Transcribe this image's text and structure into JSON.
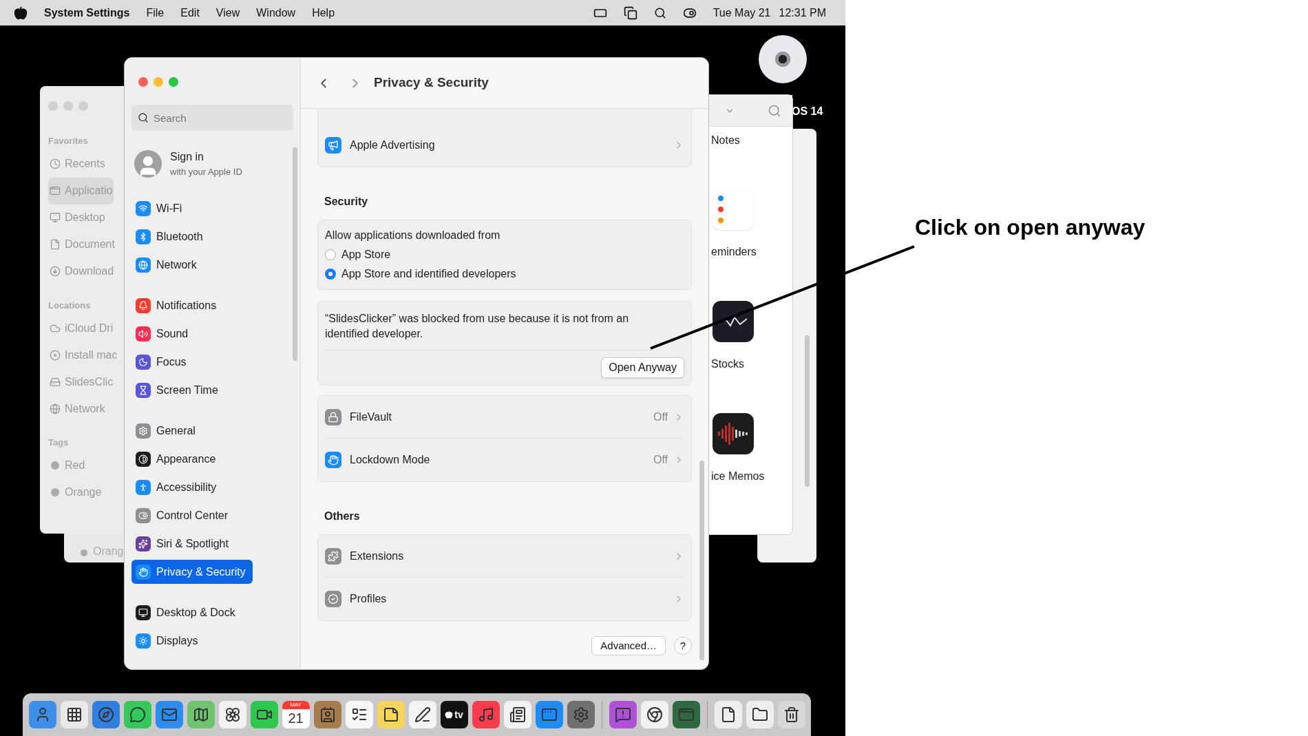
{
  "menu_bar": {
    "app": "System Settings",
    "menus": [
      "File",
      "Edit",
      "View",
      "Window",
      "Help"
    ],
    "date": "Tue May 21",
    "time": "12:31 PM"
  },
  "desktop": {
    "disc_label": "OS 14"
  },
  "finder": {
    "sections": [
      {
        "title": "Favorites",
        "items": [
          {
            "label": "Recents",
            "kind": "clock",
            "selected": false
          },
          {
            "label": "Applicatio",
            "kind": "apps",
            "selected": true
          },
          {
            "label": "Desktop",
            "kind": "desktop",
            "selected": false
          },
          {
            "label": "Document",
            "kind": "doc",
            "selected": false
          },
          {
            "label": "Download",
            "kind": "download",
            "selected": false
          }
        ]
      },
      {
        "title": "Locations",
        "items": [
          {
            "label": "iCloud Dri",
            "kind": "cloud",
            "selected": false
          },
          {
            "label": "Install mac",
            "kind": "disc",
            "selected": false
          },
          {
            "label": "SlidesClic",
            "kind": "drive",
            "selected": false
          },
          {
            "label": "Network",
            "kind": "globe",
            "selected": false
          }
        ]
      },
      {
        "title": "Tags",
        "items": [
          {
            "label": "Red",
            "kind": "tag",
            "selected": false
          },
          {
            "label": "Orange",
            "kind": "tag",
            "selected": false
          }
        ]
      }
    ],
    "back_tag": "Orang"
  },
  "right_finder": {
    "items": [
      {
        "label": "Notes",
        "kind": "notes"
      },
      {
        "label": "eminders",
        "kind": "reminders"
      },
      {
        "label": "Stocks",
        "kind": "stocks"
      },
      {
        "label": "ice Memos",
        "kind": "voice-memos"
      }
    ]
  },
  "settings": {
    "search": {
      "placeholder": "Search"
    },
    "account": {
      "title": "Sign in",
      "subtitle": "with your Apple ID"
    },
    "sidebar_groups": [
      [
        {
          "label": "Wi-Fi",
          "kind": "wifi",
          "color": "#1a8cff",
          "selected": false
        },
        {
          "label": "Bluetooth",
          "kind": "bluetooth",
          "color": "#1a8cff",
          "selected": false
        },
        {
          "label": "Network",
          "kind": "network",
          "color": "#1a8cff",
          "selected": false
        }
      ],
      [
        {
          "label": "Notifications",
          "kind": "bell",
          "color": "#ff3b30",
          "selected": false
        },
        {
          "label": "Sound",
          "kind": "sound",
          "color": "#ff2d55",
          "selected": false
        },
        {
          "label": "Focus",
          "kind": "moon",
          "color": "#5856d6",
          "selected": false
        },
        {
          "label": "Screen Time",
          "kind": "hourglass",
          "color": "#5856d6",
          "selected": false
        }
      ],
      [
        {
          "label": "General",
          "kind": "gear",
          "color": "#8e8e93",
          "selected": false
        },
        {
          "label": "Appearance",
          "kind": "appearance",
          "color": "#1c1c1e",
          "selected": false
        },
        {
          "label": "Accessibility",
          "kind": "accessibility",
          "color": "#1a8cff",
          "selected": false
        },
        {
          "label": "Control Center",
          "kind": "toggles",
          "color": "#8e8e93",
          "selected": false
        },
        {
          "label": "Siri & Spotlight",
          "kind": "siri",
          "color": "#6b3fa0",
          "selected": false
        },
        {
          "label": "Privacy & Security",
          "kind": "hand",
          "color": "#1a8cff",
          "selected": true
        }
      ],
      [
        {
          "label": "Desktop & Dock",
          "kind": "dock",
          "color": "#1c1c1e",
          "selected": false
        },
        {
          "label": "Displays",
          "kind": "sun",
          "color": "#1a8cff",
          "selected": false
        }
      ]
    ],
    "title": "Privacy & Security",
    "top_rows": [
      {
        "label": "Apple Advertising",
        "kind": "advertising"
      }
    ],
    "security": {
      "heading": "Security",
      "allow_label": "Allow applications downloaded from",
      "options": [
        {
          "label": "App Store",
          "selected": false
        },
        {
          "label": "App Store and identified developers",
          "selected": true
        }
      ],
      "blocked_message": "“SlidesClicker” was blocked from use because it is not from an identified developer.",
      "open_button": "Open Anyway"
    },
    "security_rows": [
      {
        "label": "FileVault",
        "value": "Off",
        "kind": "filevault"
      },
      {
        "label": "Lockdown Mode",
        "value": "Off",
        "kind": "lockdown"
      }
    ],
    "others": {
      "heading": "Others",
      "rows": [
        {
          "label": "Extensions",
          "kind": "extensions"
        },
        {
          "label": "Profiles",
          "kind": "profiles"
        }
      ]
    },
    "footer": {
      "advanced": "Advanced…",
      "help": "?"
    }
  },
  "dock": [
    {
      "kind": "finder"
    },
    {
      "kind": "launchpad"
    },
    {
      "kind": "safari"
    },
    {
      "kind": "messages"
    },
    {
      "kind": "mail"
    },
    {
      "kind": "maps"
    },
    {
      "kind": "photos"
    },
    {
      "kind": "facetime"
    },
    {
      "kind": "calendar",
      "month": "MAY",
      "day": "21"
    },
    {
      "kind": "contacts"
    },
    {
      "kind": "reminders"
    },
    {
      "kind": "notes"
    },
    {
      "kind": "freeform"
    },
    {
      "kind": "tv",
      "label": "tv"
    },
    {
      "kind": "music"
    },
    {
      "kind": "news"
    },
    {
      "kind": "appstore"
    },
    {
      "kind": "settings"
    },
    {
      "kind": "separator"
    },
    {
      "kind": "feedback"
    },
    {
      "kind": "chrome"
    },
    {
      "kind": "slides"
    },
    {
      "kind": "separator"
    },
    {
      "kind": "file"
    },
    {
      "kind": "folder"
    },
    {
      "kind": "trash"
    }
  ],
  "annotation": {
    "text": "Click on open anyway"
  }
}
